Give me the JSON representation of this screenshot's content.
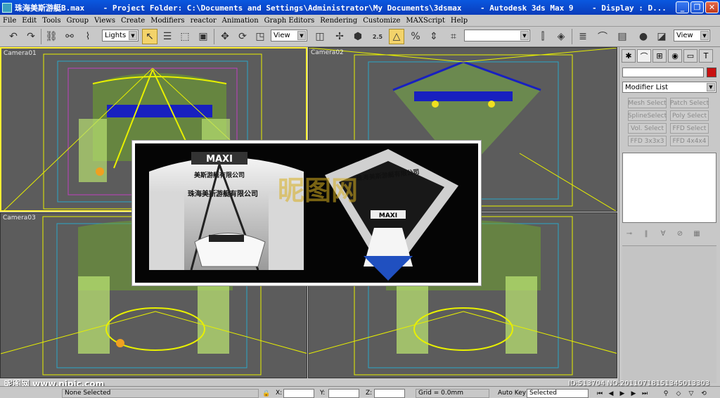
{
  "window": {
    "title": "珠海美斯游艇B.max    - Project Folder: C:\\Documents and Settings\\Administrator\\My Documents\\3dsmax    - Autodesk 3ds Max 9    - Display : D..."
  },
  "menu": [
    "File",
    "Edit",
    "Tools",
    "Group",
    "Views",
    "Create",
    "Modifiers",
    "reactor",
    "Animation",
    "Graph Editors",
    "Rendering",
    "Customize",
    "MAXScript",
    "Help"
  ],
  "toolbar": {
    "selection_filter": "Lights",
    "reference_coord": "View",
    "snap_value": "2.5",
    "right_view": "View"
  },
  "viewports": [
    {
      "label": "Camera01"
    },
    {
      "label": "Camera02"
    },
    {
      "label": "Camera03"
    },
    {
      "label": ""
    }
  ],
  "render": {
    "brand": "MAXI",
    "company": "珠海美斯游艇有限公司",
    "company_short": "美斯游艇有限公司",
    "watermark": "昵图网"
  },
  "command_panel": {
    "modifier_list": "Modifier List",
    "buttons": [
      "Mesh Select",
      "Patch Select",
      "SplineSelect",
      "Poly Select",
      "Vol. Select",
      "FFD Select",
      "FFD 3x3x3",
      "FFD 4x4x4"
    ]
  },
  "status": {
    "selection": "None Selected",
    "x_label": "X:",
    "y_label": "Y:",
    "z_label": "Z:",
    "grid": "Grid = 0.0mm",
    "auto_key": "Auto Key",
    "key_mode": "Selected"
  },
  "watermarks": {
    "left": "昵图网 www.nipic.com",
    "right": "ID:513704 NO:20110718151345013303"
  },
  "colors": {
    "title_bar": "#0a4ad0",
    "viewport_bg": "#5c5c5c",
    "active_border": "#ffef32",
    "wire_yellow": "#e8f000",
    "wire_green": "#7ec040",
    "wire_blue": "#1820c0"
  }
}
